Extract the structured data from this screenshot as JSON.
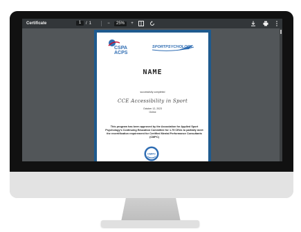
{
  "viewer": {
    "title": "Certificate",
    "page_current": "1",
    "page_sep": "/",
    "page_total": "1",
    "zoom_out": "−",
    "zoom": "25%",
    "zoom_in": "+"
  },
  "document": {
    "name_placeholder": "NAME",
    "completed_text": "successfully completed",
    "course": "CCE Accessibility in Sport",
    "date": "October 12, 2023",
    "name_line": "Online",
    "approval_text": "This program has been approved by the Association for Applied Sport Psychology's Continuing Education Committee for 1.75 CEUs to partially meet the recertification requirement for Certified Mental Performance Consultants (CMPC)"
  },
  "logos": {
    "cspa_line1": "CSPA",
    "cspa_line2": "ACPS",
    "sp_text": "SPORTPSYCHOLOGY",
    "badge": "CMPC"
  },
  "colors": {
    "viewer_bg": "#525659",
    "toolbar_bg": "#323639",
    "page_border": "#1e5a8e",
    "brand_blue": "#2f6db3"
  }
}
